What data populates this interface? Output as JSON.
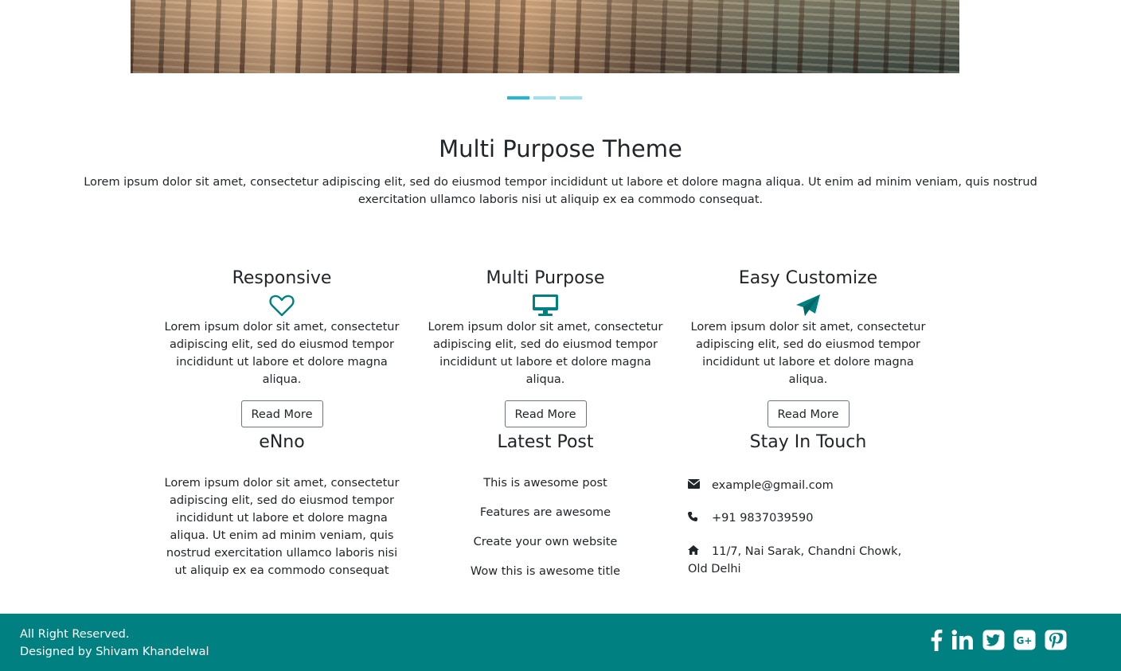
{
  "carousel": {
    "slides": 3,
    "active_index": 0
  },
  "intro": {
    "title": "Multi Purpose Theme",
    "description": "Lorem ipsum dolor sit amet, consectetur adipiscing elit, sed do eiusmod tempor incididunt ut labore et dolore magna aliqua. Ut enim ad minim veniam, quis nostrud exercitation ullamco laboris nisi ut aliquip ex ea commodo consequat."
  },
  "features": [
    {
      "title": "Responsive",
      "icon": "heart-outline-icon",
      "text": "Lorem ipsum dolor sit amet, consectetur adipiscing elit, sed do eiusmod tempor incididunt ut labore et dolore magna aliqua.",
      "button": "Read More"
    },
    {
      "title": "Multi Purpose",
      "icon": "desktop-monitor-icon",
      "text": "Lorem ipsum dolor sit amet, consectetur adipiscing elit, sed do eiusmod tempor incididunt ut labore et dolore magna aliqua.",
      "button": "Read More"
    },
    {
      "title": "Easy Customize",
      "icon": "paper-plane-icon",
      "text": "Lorem ipsum dolor sit amet, consectetur adipiscing elit, sed do eiusmod tempor incididunt ut labore et dolore magna aliqua.",
      "button": "Read More"
    }
  ],
  "about": {
    "title": "eNno",
    "text": "Lorem ipsum dolor sit amet, consectetur adipiscing elit, sed do eiusmod tempor incididunt ut labore et dolore magna aliqua. Ut enim ad minim veniam, quis nostrud exercitation ullamco laboris nisi ut aliquip ex ea commodo consequat"
  },
  "latest_post": {
    "title": "Latest Post",
    "items": [
      "This is awesome post",
      "Features are awesome",
      "Create your own website",
      "Wow this is awesome title"
    ]
  },
  "stay_in_touch": {
    "title": "Stay In Touch",
    "email": "example@gmail.com",
    "phone": "+91 9837039590",
    "address": "11/7, Nai Sarak, Chandni Chowk, Old Delhi"
  },
  "footer": {
    "line1": "All Right Reserved.",
    "line2": "Designed by Shivam Khandelwal",
    "social": [
      "facebook-icon",
      "linkedin-icon",
      "twitter-icon",
      "google-plus-icon",
      "pinterest-icon"
    ]
  },
  "colors": {
    "accent": "#008080",
    "indicator_active": "#1fb6d9",
    "indicator_inactive": "#9fe0ef"
  }
}
